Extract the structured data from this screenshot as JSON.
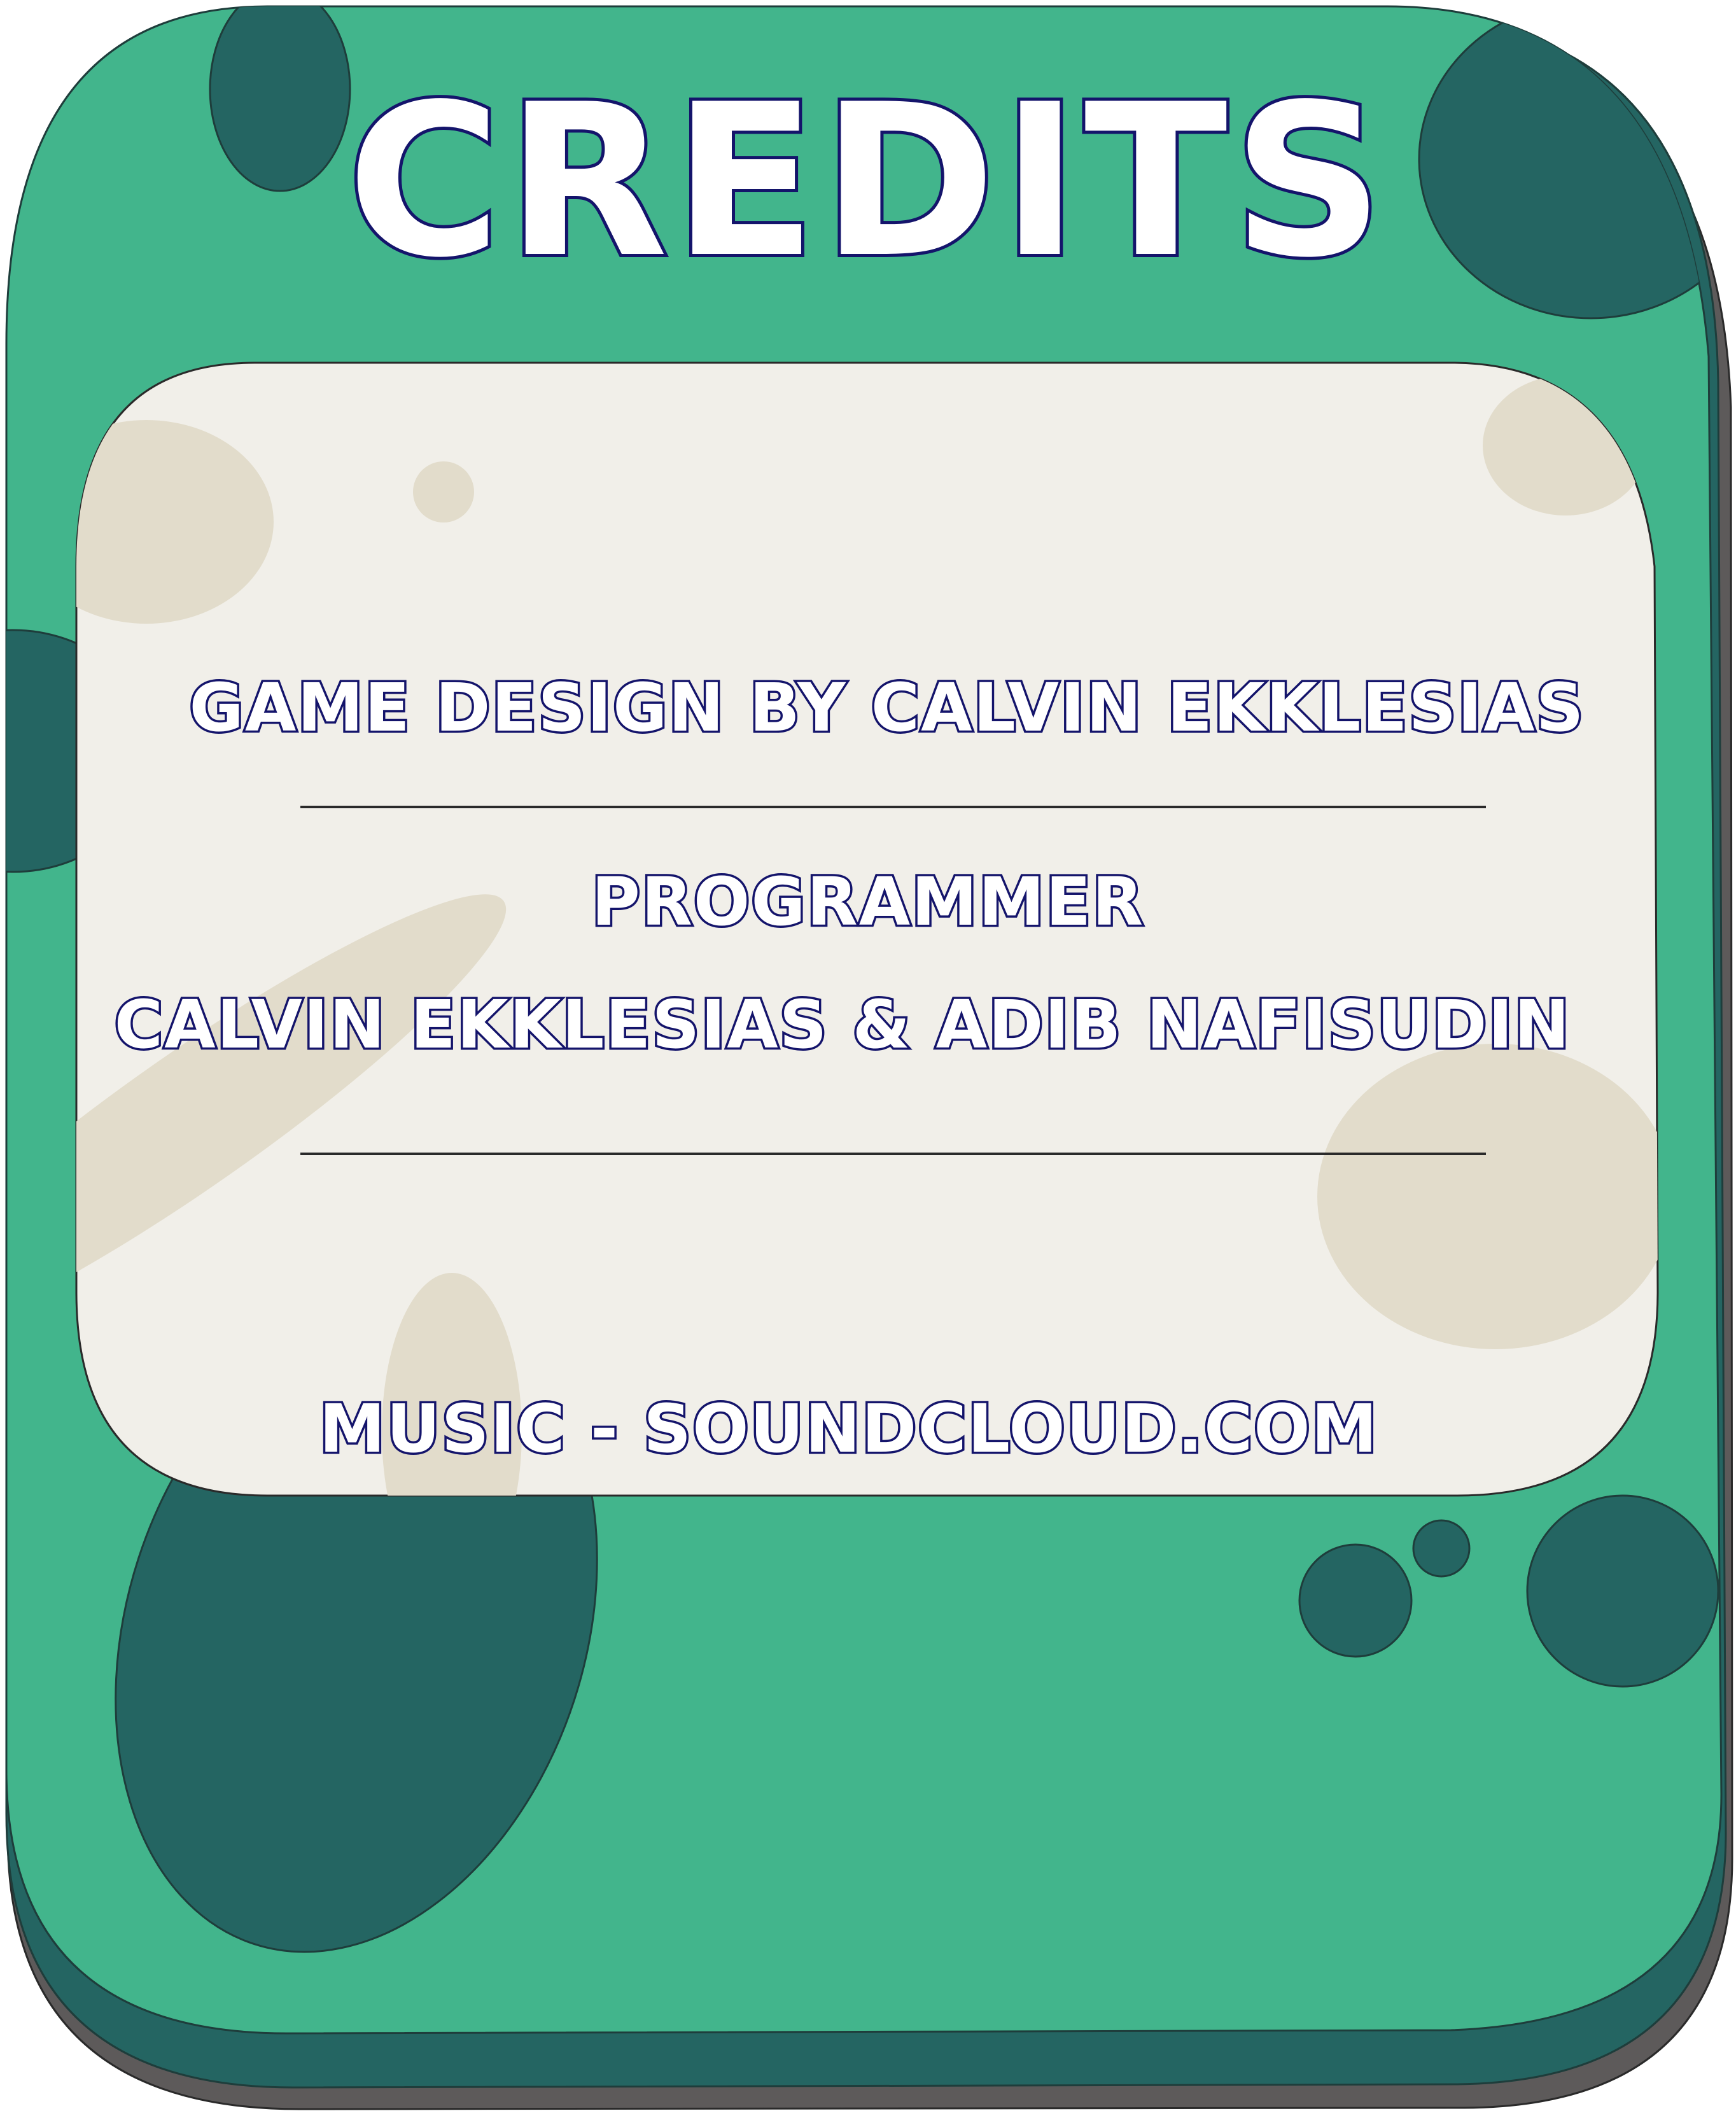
{
  "title": "CREDITS",
  "credits": [
    "GAME DESIGN BY CALVIN EKKLESIAS",
    "PROGRAMMER",
    "CALVIN EKKLESIAS & ADIB NAFISUDIN",
    "MUSIC - SOUNDCLOUD.COM"
  ],
  "colors": {
    "shadow": "#5d5a5a",
    "panel_dark": "#246562",
    "panel": "#42b58c",
    "card": "#f1efe9",
    "card_spot": "#e2dccb",
    "text_fill": "#ffffff",
    "text_outline": "#14146b"
  }
}
